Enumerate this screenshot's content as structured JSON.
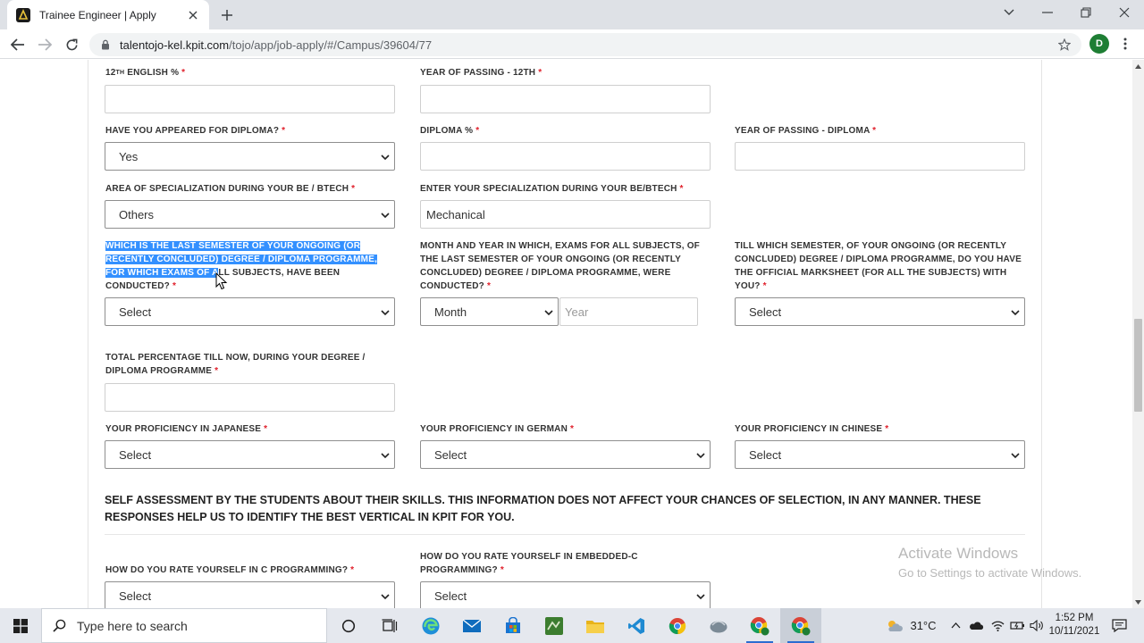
{
  "browser": {
    "tab_title": "Trainee Engineer | Apply",
    "url_host": "talentojo-kel.kpit.com",
    "url_path": "/tojo/app/job-apply/#/Campus/39604/77",
    "profile_initial": "D"
  },
  "form": {
    "row1": {
      "english12_label": "12",
      "english12_sup": "TH",
      "english12_label_rest": " ENGLISH %",
      "year12_label": "YEAR OF PASSING - 12TH"
    },
    "row2": {
      "diploma_appeared_label": "HAVE YOU APPEARED FOR DIPLOMA?",
      "diploma_appeared_value": "Yes",
      "diploma_pct_label": "DIPLOMA %",
      "diploma_year_label": "YEAR OF PASSING - DIPLOMA"
    },
    "row3": {
      "specialization_area_label": "AREA OF SPECIALIZATION DURING YOUR BE / BTECH",
      "specialization_area_value": "Others",
      "specialization_label": "ENTER YOUR SPECIALIZATION DURING YOUR BE/BTECH",
      "specialization_value": "Mechanical"
    },
    "row4": {
      "last_sem_label_hl1": "WHICH IS THE LAST SEMESTER OF YOUR ONGOING (OR",
      "last_sem_label_hl2": "RECENTLY CONCLUDED) DEGREE / DIPLOMA PROGRAMME,",
      "last_sem_label_hl3": "FOR WHICH EXAMS OF A",
      "last_sem_label_rest3": "LL SUBJECTS, HAVE BEEN",
      "last_sem_label_4": "CONDUCTED?",
      "last_sem_value": "Select",
      "exam_month_label_1": "MONTH AND YEAR IN WHICH, EXAMS FOR ALL SUBJECTS, OF",
      "exam_month_label_2": "THE LAST SEMESTER OF YOUR ONGOING (OR RECENTLY",
      "exam_month_label_3": "CONCLUDED) DEGREE / DIPLOMA PROGRAMME, WERE",
      "exam_month_label_4": "CONDUCTED?",
      "month_value": "Month",
      "year_placeholder": "Year",
      "marksheet_label_1": "TILL WHICH SEMESTER, OF YOUR ONGOING (OR RECENTLY",
      "marksheet_label_2": "CONCLUDED) DEGREE / DIPLOMA PROGRAMME, DO YOU HAVE",
      "marksheet_label_3": "THE OFFICIAL MARKSHEET (FOR ALL THE SUBJECTS) WITH",
      "marksheet_label_4": "YOU?",
      "marksheet_value": "Select"
    },
    "row5": {
      "total_pct_label_1": "TOTAL PERCENTAGE TILL NOW, DURING YOUR DEGREE /",
      "total_pct_label_2": "DIPLOMA PROGRAMME"
    },
    "row6": {
      "japanese_label": "YOUR PROFICIENCY IN JAPANESE",
      "japanese_value": "Select",
      "german_label": "YOUR PROFICIENCY IN GERMAN",
      "german_value": "Select",
      "chinese_label": "YOUR PROFICIENCY IN CHINESE",
      "chinese_value": "Select"
    },
    "self_assessment_title": "SELF ASSESSMENT BY THE STUDENTS ABOUT THEIR SKILLS. THIS INFORMATION DOES NOT AFFECT YOUR CHANCES OF SELECTION, IN ANY MANNER. THESE RESPONSES HELP US TO IDENTIFY THE BEST VERTICAL IN KPIT FOR YOU.",
    "row7": {
      "c_label": "HOW DO YOU RATE YOURSELF IN C PROGRAMMING?",
      "c_value": "Select",
      "embedded_label_1": "HOW DO YOU RATE YOURSELF IN EMBEDDED-C",
      "embedded_label_2": "PROGRAMMING?",
      "embedded_value": "Select"
    },
    "required_mark": "*"
  },
  "watermark": {
    "line1": "Activate Windows",
    "line2": "Go to Settings to activate Windows."
  },
  "taskbar": {
    "search_placeholder": "Type here to search",
    "weather": "31°C",
    "time": "1:52 PM",
    "date": "10/11/2021"
  }
}
